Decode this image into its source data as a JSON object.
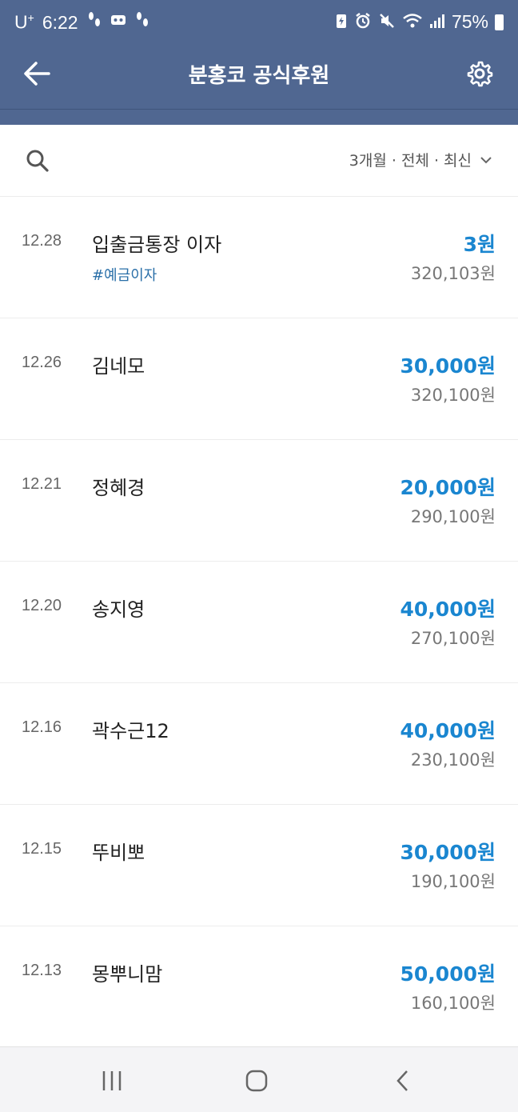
{
  "status_bar": {
    "carrier": "U",
    "carrier_sup": "+",
    "time": "6:22",
    "battery": "75%"
  },
  "header": {
    "title": "분홍코 공식후원"
  },
  "filter": {
    "label": "3개월 · 전체 · 최신"
  },
  "transactions": [
    {
      "date": "12.28",
      "name": "입출금통장 이자",
      "tag": "#예금이자",
      "amount": "3원",
      "balance": "320,103원"
    },
    {
      "date": "12.26",
      "name": "김네모",
      "tag": "",
      "amount": "30,000원",
      "balance": "320,100원"
    },
    {
      "date": "12.21",
      "name": "정혜경",
      "tag": "",
      "amount": "20,000원",
      "balance": "290,100원"
    },
    {
      "date": "12.20",
      "name": "송지영",
      "tag": "",
      "amount": "40,000원",
      "balance": "270,100원"
    },
    {
      "date": "12.16",
      "name": "곽수근12",
      "tag": "",
      "amount": "40,000원",
      "balance": "230,100원"
    },
    {
      "date": "12.15",
      "name": "뚜비뽀",
      "tag": "",
      "amount": "30,000원",
      "balance": "190,100원"
    },
    {
      "date": "12.13",
      "name": "몽뿌니맘",
      "tag": "",
      "amount": "50,000원",
      "balance": "160,100원"
    }
  ],
  "colors": {
    "header_bg": "#506791",
    "amount": "#1a86d0",
    "tag": "#2a6fa8"
  }
}
